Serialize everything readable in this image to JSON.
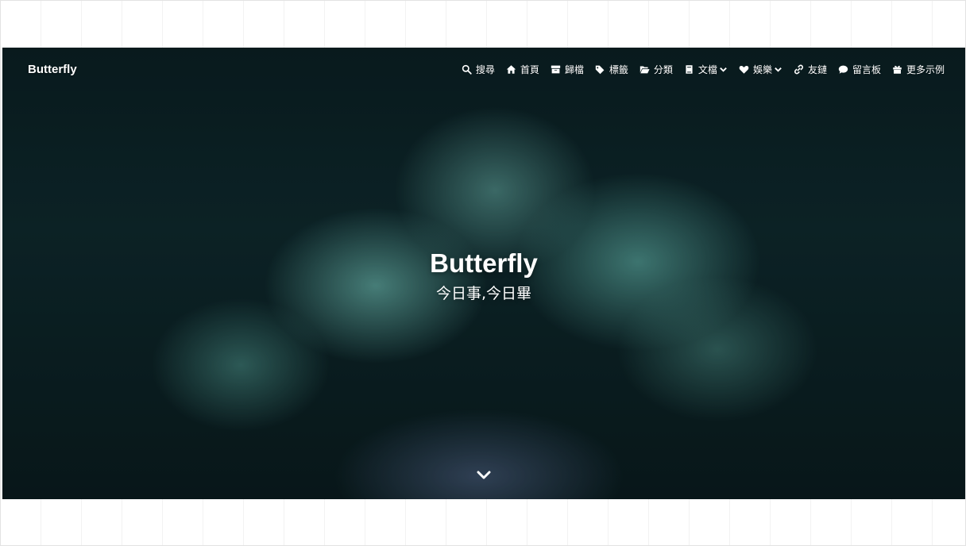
{
  "navbar": {
    "site_name": "Butterfly",
    "menu": [
      {
        "label": "搜尋",
        "icon": "search-icon",
        "has_caret": false
      },
      {
        "label": "首頁",
        "icon": "home-icon",
        "has_caret": false
      },
      {
        "label": "歸檔",
        "icon": "archive-icon",
        "has_caret": false
      },
      {
        "label": "標籤",
        "icon": "tags-icon",
        "has_caret": false
      },
      {
        "label": "分類",
        "icon": "folder-open-icon",
        "has_caret": false
      },
      {
        "label": "文檔",
        "icon": "book-icon",
        "has_caret": true
      },
      {
        "label": "娛樂",
        "icon": "heart-icon",
        "has_caret": true
      },
      {
        "label": "友鏈",
        "icon": "link-icon",
        "has_caret": false
      },
      {
        "label": "留言板",
        "icon": "comment-icon",
        "has_caret": false
      },
      {
        "label": "更多示例",
        "icon": "gift-icon",
        "has_caret": false
      }
    ]
  },
  "hero": {
    "title": "Butterfly",
    "subtitle": "今日事,今日畢"
  },
  "colors": {
    "text": "#ffffff",
    "hero_dark": "#0b2024",
    "smoke": "#6ebeb4"
  }
}
